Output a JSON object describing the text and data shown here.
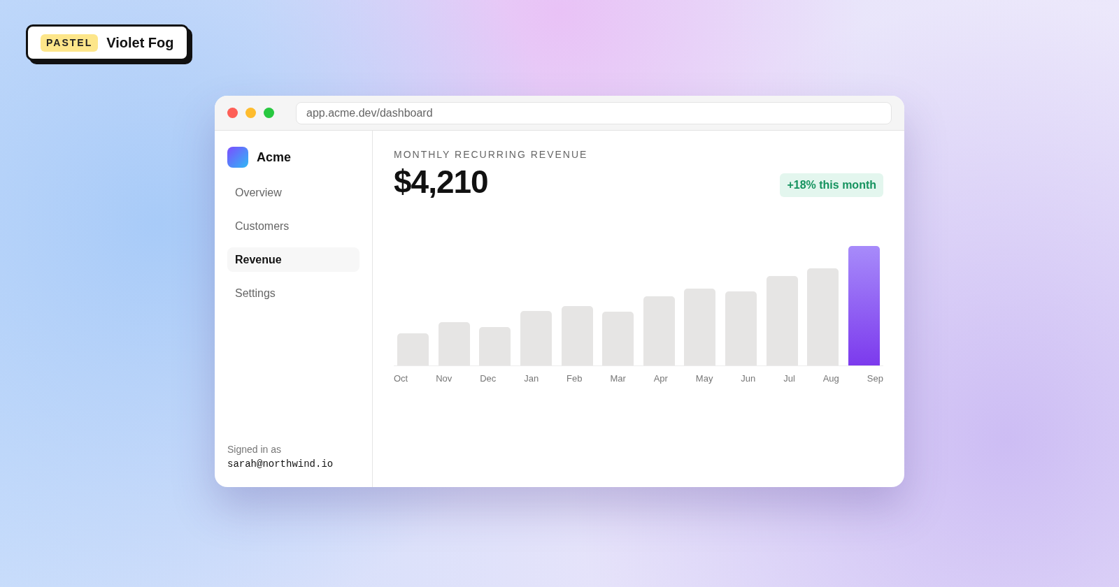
{
  "badge": {
    "tag": "PASTEL",
    "title": "Violet Fog"
  },
  "browser": {
    "url": "app.acme.dev/dashboard"
  },
  "sidebar": {
    "brand": "Acme",
    "items": [
      {
        "label": "Overview",
        "selected": false
      },
      {
        "label": "Customers",
        "selected": false
      },
      {
        "label": "Revenue",
        "selected": true
      },
      {
        "label": "Settings",
        "selected": false
      }
    ],
    "footer": {
      "caption": "Signed in as",
      "email": "sarah@northwind.io"
    }
  },
  "main": {
    "heading": "MONTHLY RECURRING REVENUE",
    "amount": "$4,210",
    "change": "+18% this month",
    "months": [
      {
        "label": "Oct",
        "selected": false
      },
      {
        "label": "Nov",
        "selected": false
      },
      {
        "label": "Dec",
        "selected": false
      },
      {
        "label": "Jan",
        "selected": false
      },
      {
        "label": "Feb",
        "selected": false
      },
      {
        "label": "Mar",
        "selected": false
      },
      {
        "label": "Apr",
        "selected": false
      },
      {
        "label": "May",
        "selected": false
      },
      {
        "label": "Jun",
        "selected": false
      },
      {
        "label": "Jul",
        "selected": false
      },
      {
        "label": "Aug",
        "selected": false
      },
      {
        "label": "Sep",
        "selected": true
      }
    ]
  }
}
